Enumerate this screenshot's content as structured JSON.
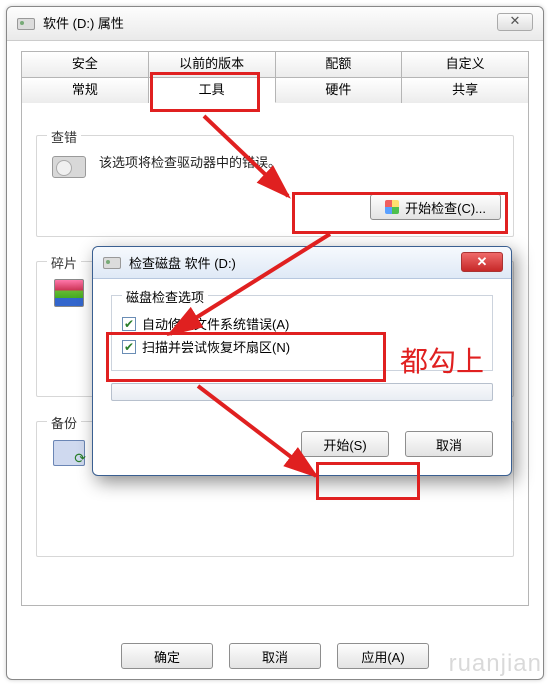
{
  "window": {
    "title": "软件 (D:) 属性",
    "close_glyph": "✕"
  },
  "tabs": {
    "row1": [
      "安全",
      "以前的版本",
      "配额",
      "自定义"
    ],
    "row2": [
      "常规",
      "工具",
      "硬件",
      "共享"
    ],
    "active": "工具"
  },
  "groups": {
    "check": {
      "title": "查错",
      "text": "该选项将检查驱动器中的错误。",
      "button": "开始检查(C)..."
    },
    "defrag": {
      "title": "碎片"
    },
    "backup": {
      "title": "备份"
    }
  },
  "bottom": {
    "ok": "确定",
    "cancel": "取消",
    "apply": "应用(A)"
  },
  "dialog": {
    "title": "检查磁盘 软件 (D:)",
    "close_glyph": "✕",
    "fieldset_title": "磁盘检查选项",
    "opt1": "自动修复文件系统错误(A)",
    "opt2": "扫描并尝试恢复坏扇区(N)",
    "start": "开始(S)",
    "cancel": "取消"
  },
  "annotation": {
    "check_both": "都勾上"
  },
  "icons": {
    "drive": "drive-icon",
    "shield": "shield-icon",
    "hdd": "hdd-icon",
    "defrag": "defrag-icon",
    "backup": "backup-icon"
  },
  "colors": {
    "highlight": "#e02020",
    "dialog_border": "#3a5f91"
  }
}
